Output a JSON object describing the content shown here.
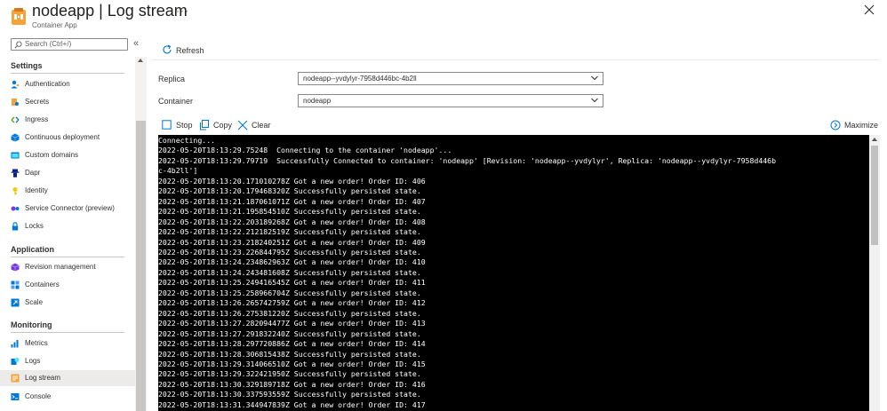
{
  "header": {
    "title": "nodeapp | Log stream",
    "subtitle": "Container App",
    "more": "···"
  },
  "sidebar": {
    "search_placeholder": "Search (Ctrl+/)",
    "collapse": "«",
    "sections": {
      "settings": "Settings",
      "application": "Application",
      "monitoring": "Monitoring"
    },
    "items": [
      {
        "label": "Authentication",
        "icon": "user-key-icon"
      },
      {
        "label": "Secrets",
        "icon": "key-icon"
      },
      {
        "label": "Ingress",
        "icon": "ingress-icon"
      },
      {
        "label": "Continuous deployment",
        "icon": "cube-icon"
      },
      {
        "label": "Custom domains",
        "icon": "globe-icon"
      },
      {
        "label": "Dapr",
        "icon": "dapr-icon"
      },
      {
        "label": "Identity",
        "icon": "identity-icon"
      },
      {
        "label": "Service Connector (preview)",
        "icon": "connector-icon"
      },
      {
        "label": "Locks",
        "icon": "lock-icon"
      },
      {
        "label": "Revision management",
        "icon": "revision-icon"
      },
      {
        "label": "Containers",
        "icon": "containers-icon"
      },
      {
        "label": "Scale",
        "icon": "scale-icon"
      },
      {
        "label": "Metrics",
        "icon": "metrics-icon"
      },
      {
        "label": "Logs",
        "icon": "logs-icon"
      },
      {
        "label": "Log stream",
        "icon": "log-stream-icon"
      },
      {
        "label": "Console",
        "icon": "console-icon"
      }
    ]
  },
  "toolbar": {
    "refresh": "Refresh",
    "stop": "Stop",
    "copy": "Copy",
    "clear": "Clear",
    "maximize": "Maximize"
  },
  "form": {
    "replica_label": "Replica",
    "replica_value": "nodeapp--yvdylyr-7958d446bc-4b2ll",
    "container_label": "Container",
    "container_value": "nodeapp"
  },
  "console": {
    "lines": [
      "Connecting...",
      "2022-05-20T18:13:29.75248  Connecting to the container 'nodeapp'...",
      "2022-05-20T18:13:29.79719  Successfully Connected to container: 'nodeapp' [Revision: 'nodeapp--yvdylyr', Replica: 'nodeapp--yvdylyr-7958d446b",
      "c-4b2ll']",
      "2022-05-20T18:13:20.171010278Z Got a new order! Order ID: 406",
      "2022-05-20T18:13:20.179468320Z Successfully persisted state.",
      "2022-05-20T18:13:21.187061071Z Got a new order! Order ID: 407",
      "2022-05-20T18:13:21.195854510Z Successfully persisted state.",
      "2022-05-20T18:13:22.203189268Z Got a new order! Order ID: 408",
      "2022-05-20T18:13:22.212182519Z Successfully persisted state.",
      "2022-05-20T18:13:23.218240251Z Got a new order! Order ID: 409",
      "2022-05-20T18:13:23.226844795Z Successfully persisted state.",
      "2022-05-20T18:13:24.234862963Z Got a new order! Order ID: 410",
      "2022-05-20T18:13:24.243481608Z Successfully persisted state.",
      "2022-05-20T18:13:25.249416545Z Got a new order! Order ID: 411",
      "2022-05-20T18:13:25.258966704Z Successfully persisted state.",
      "2022-05-20T18:13:26.265742759Z Got a new order! Order ID: 412",
      "2022-05-20T18:13:26.275381220Z Successfully persisted state.",
      "2022-05-20T18:13:27.282094477Z Got a new order! Order ID: 413",
      "2022-05-20T18:13:27.291832240Z Successfully persisted state.",
      "2022-05-20T18:13:28.297720886Z Got a new order! Order ID: 414",
      "2022-05-20T18:13:28.306815438Z Successfully persisted state.",
      "2022-05-20T18:13:29.314066510Z Got a new order! Order ID: 415",
      "2022-05-20T18:13:29.322421950Z Successfully persisted state.",
      "2022-05-20T18:13:30.329189718Z Got a new order! Order ID: 416",
      "2022-05-20T18:13:30.337593559Z Successfully persisted state.",
      "2022-05-20T18:13:31.344947839Z Got a new order! Order ID: 417"
    ]
  },
  "colors": {
    "accent": "#0078d4",
    "selected_bg": "#edebe9",
    "console_bg": "#000000",
    "console_fg": "#ffffff"
  }
}
